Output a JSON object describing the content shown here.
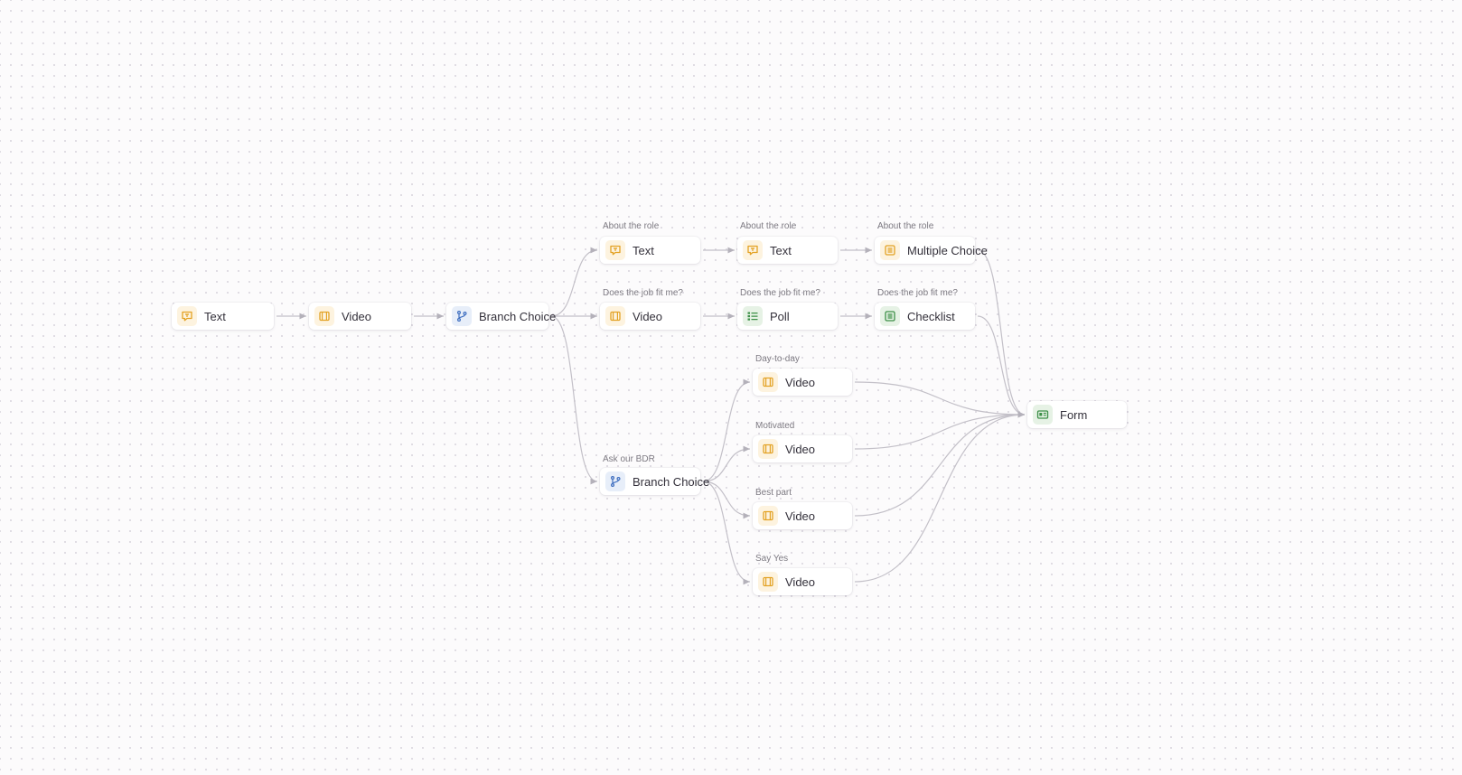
{
  "colors": {
    "text_icon": "#e3a224",
    "video_icon": "#e3a224",
    "branch_icon": "#3f6fc0",
    "green_icon": "#3c8f47",
    "edge": "#c3c0c8"
  },
  "nodes": [
    {
      "id": "n1",
      "label": "Text",
      "caption": "",
      "icon": "message-square-icon"
    },
    {
      "id": "n2",
      "label": "Video",
      "caption": "",
      "icon": "film-icon"
    },
    {
      "id": "n3",
      "label": "Branch Choice",
      "caption": "",
      "icon": "git-branch-icon"
    },
    {
      "id": "n4",
      "label": "Text",
      "caption": "About the role",
      "icon": "message-square-icon"
    },
    {
      "id": "n5",
      "label": "Text",
      "caption": "About the role",
      "icon": "message-square-icon"
    },
    {
      "id": "n6",
      "label": "Multiple Choice",
      "caption": "About the role",
      "icon": "list-box-icon"
    },
    {
      "id": "n7",
      "label": "Video",
      "caption": "Does the job fit me?",
      "icon": "film-icon"
    },
    {
      "id": "n8",
      "label": "Poll",
      "caption": "Does the job fit me?",
      "icon": "poll-list-icon"
    },
    {
      "id": "n9",
      "label": "Checklist",
      "caption": "Does the job fit me?",
      "icon": "checklist-icon"
    },
    {
      "id": "n10",
      "label": "Branch Choice",
      "caption": "Ask our BDR",
      "icon": "git-branch-icon"
    },
    {
      "id": "n11",
      "label": "Video",
      "caption": "Day-to-day",
      "icon": "film-icon"
    },
    {
      "id": "n12",
      "label": "Video",
      "caption": "Motivated",
      "icon": "film-icon"
    },
    {
      "id": "n13",
      "label": "Video",
      "caption": "Best part",
      "icon": "film-icon"
    },
    {
      "id": "n14",
      "label": "Video",
      "caption": "Say Yes",
      "icon": "film-icon"
    },
    {
      "id": "n15",
      "label": "Form",
      "caption": "",
      "icon": "form-card-icon"
    }
  ],
  "edges": [
    [
      "n1",
      "n2"
    ],
    [
      "n2",
      "n3"
    ],
    [
      "n3",
      "n4"
    ],
    [
      "n3",
      "n7"
    ],
    [
      "n3",
      "n10"
    ],
    [
      "n4",
      "n5"
    ],
    [
      "n5",
      "n6"
    ],
    [
      "n7",
      "n8"
    ],
    [
      "n8",
      "n9"
    ],
    [
      "n10",
      "n11"
    ],
    [
      "n10",
      "n12"
    ],
    [
      "n10",
      "n13"
    ],
    [
      "n10",
      "n14"
    ],
    [
      "n6",
      "n15"
    ],
    [
      "n9",
      "n15"
    ],
    [
      "n11",
      "n15"
    ],
    [
      "n12",
      "n15"
    ],
    [
      "n13",
      "n15"
    ],
    [
      "n14",
      "n15"
    ]
  ]
}
